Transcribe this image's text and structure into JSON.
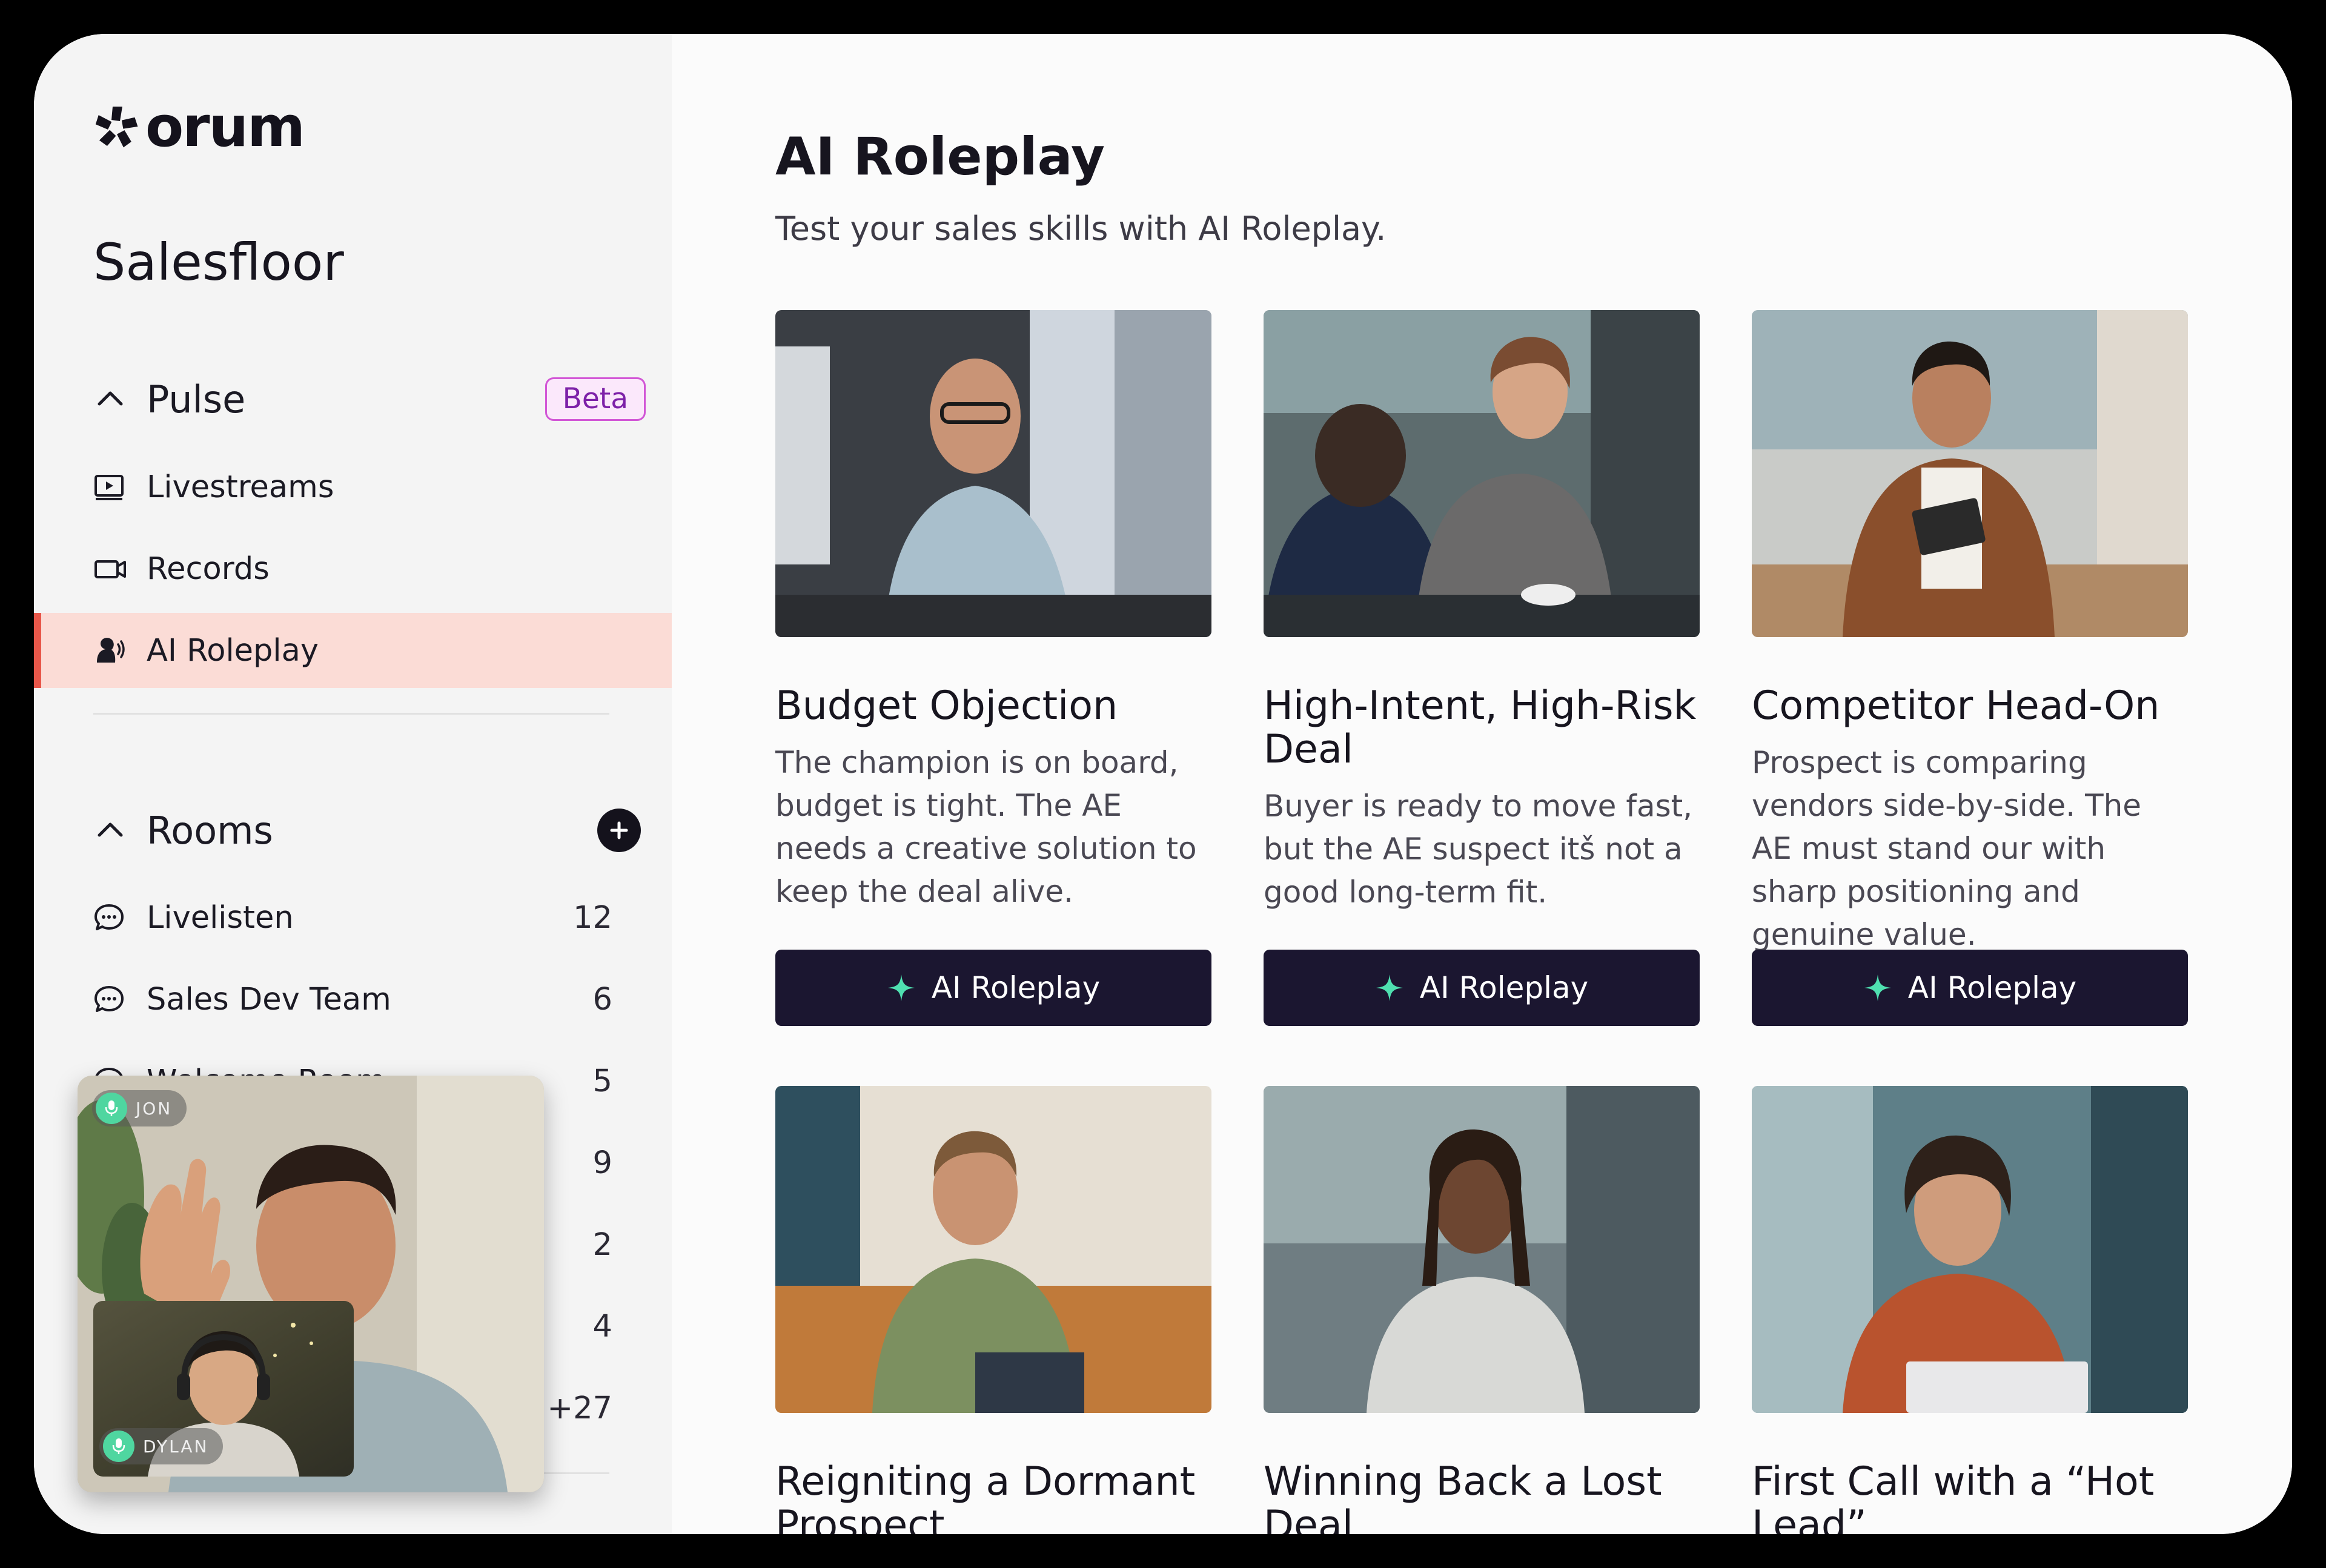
{
  "brand": {
    "logo_text": "orum"
  },
  "sidebar": {
    "title": "Salesfloor",
    "pulse": {
      "label": "Pulse",
      "badge": "Beta",
      "items": [
        {
          "label": "Livestreams",
          "icon": "livestream-icon"
        },
        {
          "label": "Records",
          "icon": "video-camera-icon"
        },
        {
          "label": "AI Roleplay",
          "icon": "speaking-head-icon",
          "active": true
        }
      ]
    },
    "rooms": {
      "label": "Rooms",
      "items": [
        {
          "label": "Livelisten",
          "count": "12"
        },
        {
          "label": "Sales Dev Team",
          "count": "6"
        },
        {
          "label": "Welcome Room",
          "count": "5"
        }
      ],
      "hidden_counts": [
        "9",
        "2",
        "4",
        "+27"
      ]
    },
    "video_call": {
      "main_participant": "JON",
      "inset_participant": "DYLAN"
    }
  },
  "main": {
    "title": "AI Roleplay",
    "subtitle": "Test your sales skills with AI Roleplay.",
    "cards": [
      {
        "title": "Budget Objection",
        "description": "The champion is on board, budget is tight. The AE needs a creative solution to keep the deal alive.",
        "button": "AI Roleplay"
      },
      {
        "title": "High-Intent, High-Risk Deal",
        "description": "Buyer is ready to move fast, but the AE suspect itš not a good long-term fit.",
        "button": "AI Roleplay"
      },
      {
        "title": "Competitor Head-On",
        "description": "Prospect is comparing vendors side-by-side. The AE must stand our with sharp positioning and genuine value.",
        "button": "AI Roleplay"
      },
      {
        "title": "Reigniting a Dormant Prospect"
      },
      {
        "title": "Winning Back a Lost Deal"
      },
      {
        "title": "First Call with a “Hot Lead”"
      }
    ]
  },
  "colors": {
    "accent": "#e8574a",
    "active_bg": "#fbdcd6",
    "button_bg": "#1b1630",
    "sparkle": "#4fe0b0",
    "beta_text": "#7d21a8"
  }
}
